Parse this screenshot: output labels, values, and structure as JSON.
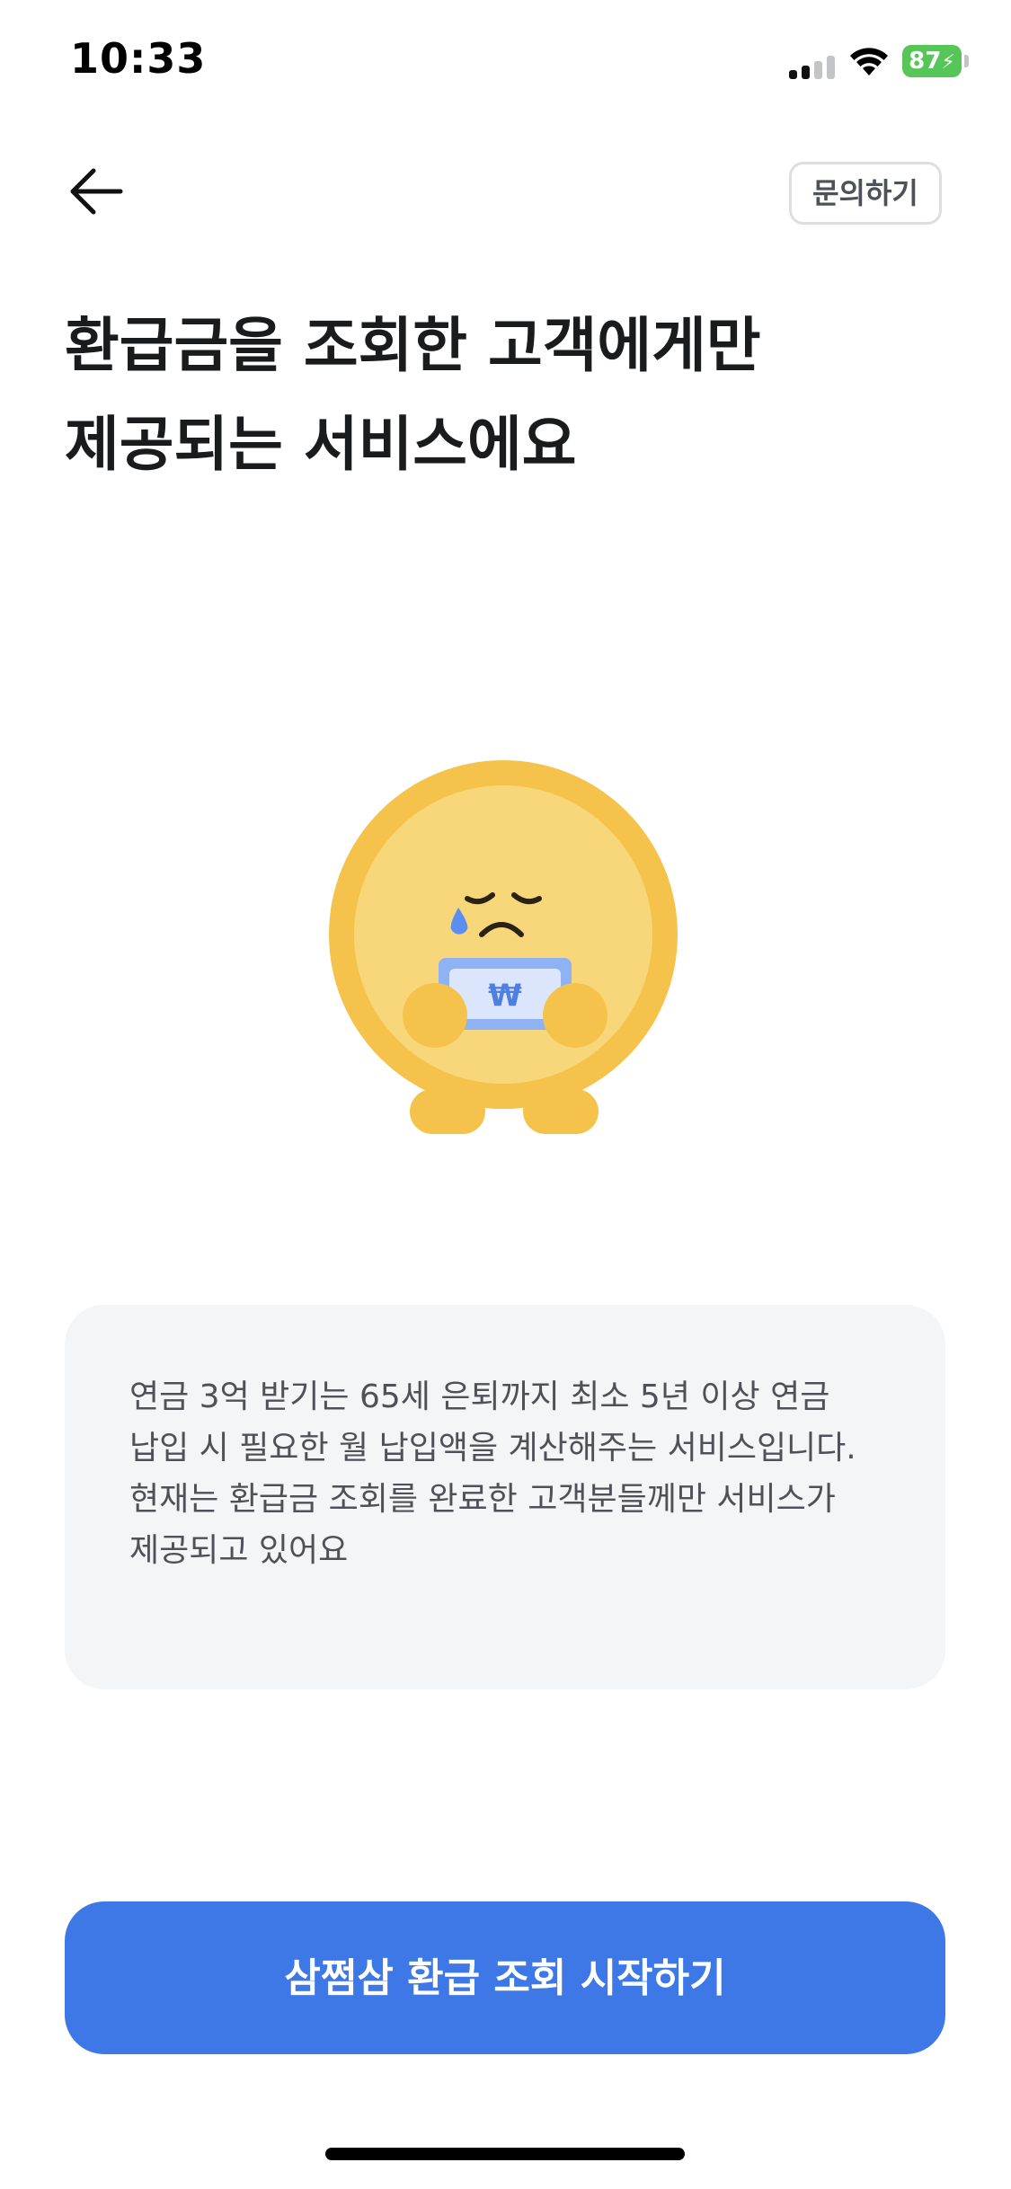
{
  "status_bar": {
    "time": "10:33",
    "battery_level": "87",
    "signal_bars_active": 2,
    "signal_bars_total": 4,
    "icons": [
      "signal-icon",
      "wifi-icon",
      "battery-charging-icon"
    ]
  },
  "header": {
    "back_icon": "arrow-left-icon",
    "inquiry_label": "문의하기"
  },
  "page": {
    "title": "환급금을 조회한 고객에게만\n제공되는 서비스에요"
  },
  "illustration": {
    "icon": "sad-coin-mascot-icon",
    "banknote_symbol": "₩"
  },
  "info_card": {
    "line_1": "연금 3억 받기는 65세 은퇴까지 최소 5년 이상 연금 납입 시 필요한 월 납입액을 계산해주는 서비스입니다.",
    "line_2": "현재는 환급금 조회를 완료한 고객분들께만 서비스가 제공되고 있어요"
  },
  "cta": {
    "label": "삼쩜삼 환급 조회 시작하기"
  },
  "colors": {
    "primary": "#3d78e6",
    "coin_outer": "#f5c34b",
    "coin_inner": "#f8d67a",
    "card_background": "#f4f5f7",
    "battery": "#55c657"
  }
}
